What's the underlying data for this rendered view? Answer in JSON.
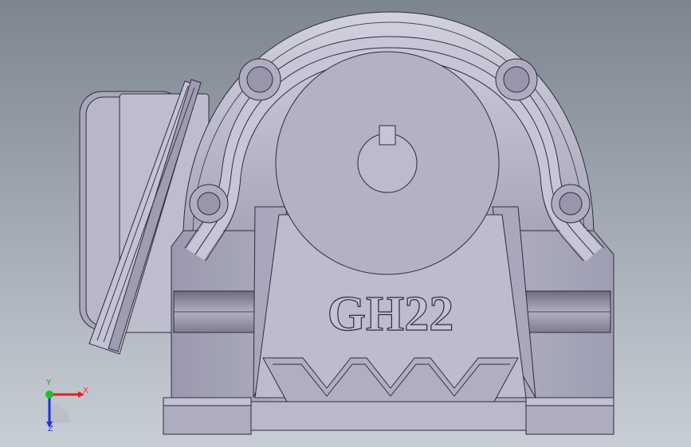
{
  "viewport": {
    "background_top": "#7d8590",
    "background_bottom": "#c9ced6"
  },
  "model": {
    "label": "GH22",
    "body_color": "#b9b8c8",
    "shade_color": "#8e8c9e",
    "edge_color": "#2e2c3a"
  },
  "triad": {
    "x_label": "X",
    "y_label": "Y",
    "z_label": "Z",
    "x_color": "#e02020",
    "y_color": "#20c020",
    "z_color": "#2030e0"
  }
}
